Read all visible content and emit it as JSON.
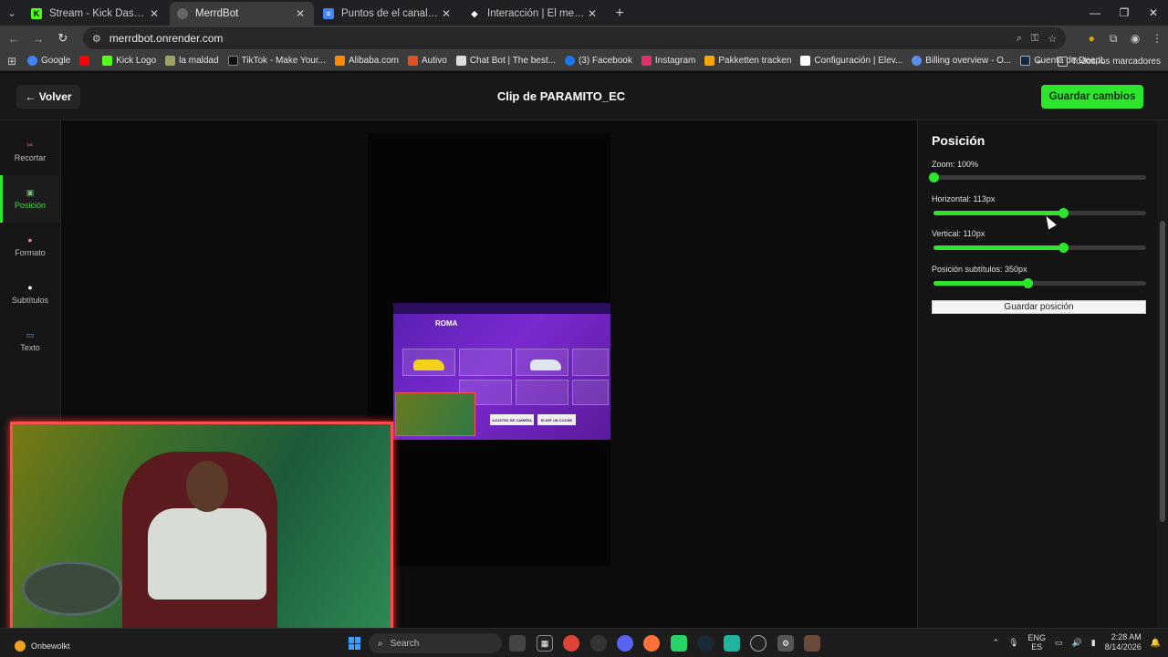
{
  "browser": {
    "tabs": [
      {
        "label": "Stream - Kick Dashboard",
        "favicon": "K",
        "color": "#53fc18"
      },
      {
        "label": "MerrdBot",
        "favicon": "",
        "color": "#888888"
      },
      {
        "label": "Puntos de el canal. - Document",
        "favicon": "≡",
        "color": "#4285f4"
      },
      {
        "label": "Interacción | El mejor software",
        "favicon": "◆",
        "color": "#ffffff"
      }
    ],
    "url": "merrdbot.onrender.com",
    "bookmarks": [
      {
        "label": "Google",
        "color": "#4285f4"
      },
      {
        "label": "",
        "color": "#ff0000"
      },
      {
        "label": "Kick Logo",
        "color": "#53fc18"
      },
      {
        "label": "la maldad",
        "color": "#a0a060"
      },
      {
        "label": "TikTok - Make Your...",
        "color": "#111111"
      },
      {
        "label": "Alibaba.com",
        "color": "#ff8a00"
      },
      {
        "label": "Autivo",
        "color": "#e05020"
      },
      {
        "label": "Chat Bot | The best...",
        "color": "#dddddd"
      },
      {
        "label": "(3) Facebook",
        "color": "#1877f2"
      },
      {
        "label": "Instagram",
        "color": "#e1306c"
      },
      {
        "label": "Pakketten tracken",
        "color": "#f6a600"
      },
      {
        "label": "Configuración | Elev...",
        "color": "#ffffff"
      },
      {
        "label": "Billing overview - O...",
        "color": "#5a8dee"
      },
      {
        "label": "Cuenta de DeepL",
        "color": "#0f2b46"
      }
    ],
    "bookmarks_folder": "Todos los marcadores"
  },
  "app": {
    "back_label": "← Volver",
    "title": "Clip de PARAMITO_EC",
    "save_label": "Guardar cambios",
    "sidebar": [
      {
        "label": "Recortar",
        "icon": "scissors-icon",
        "glyph": "✂",
        "active": false
      },
      {
        "label": "Posición",
        "icon": "picture-icon",
        "glyph": "▣",
        "active": true
      },
      {
        "label": "Formato",
        "icon": "palette-icon",
        "glyph": "●",
        "active": false
      },
      {
        "label": "Subtítulos",
        "icon": "speech-bubble-icon",
        "glyph": "●",
        "active": false
      },
      {
        "label": "Texto",
        "icon": "text-icon",
        "glyph": "▭",
        "active": false
      }
    ]
  },
  "game": {
    "title": "ROMA",
    "buttons": [
      "AJUSTES DE CAMERA",
      "ELIGE UN COCHE"
    ]
  },
  "panel": {
    "title": "Posición",
    "controls": [
      {
        "label": "Zoom: 100%",
        "value": 0.0
      },
      {
        "label": "Horizontal: 113px",
        "value": 0.61
      },
      {
        "label": "Vertical: 110px",
        "value": 0.61
      },
      {
        "label": "Posición subtítulos: 350px",
        "value": 0.44
      }
    ],
    "save_position_label": "Guardar posición"
  },
  "taskbar": {
    "weather": "Onbewolkt",
    "search_placeholder": "Search",
    "lang_top": "ENG",
    "lang_bottom": "ES",
    "time": "2:28 AM",
    "date": "8/14/2026"
  }
}
